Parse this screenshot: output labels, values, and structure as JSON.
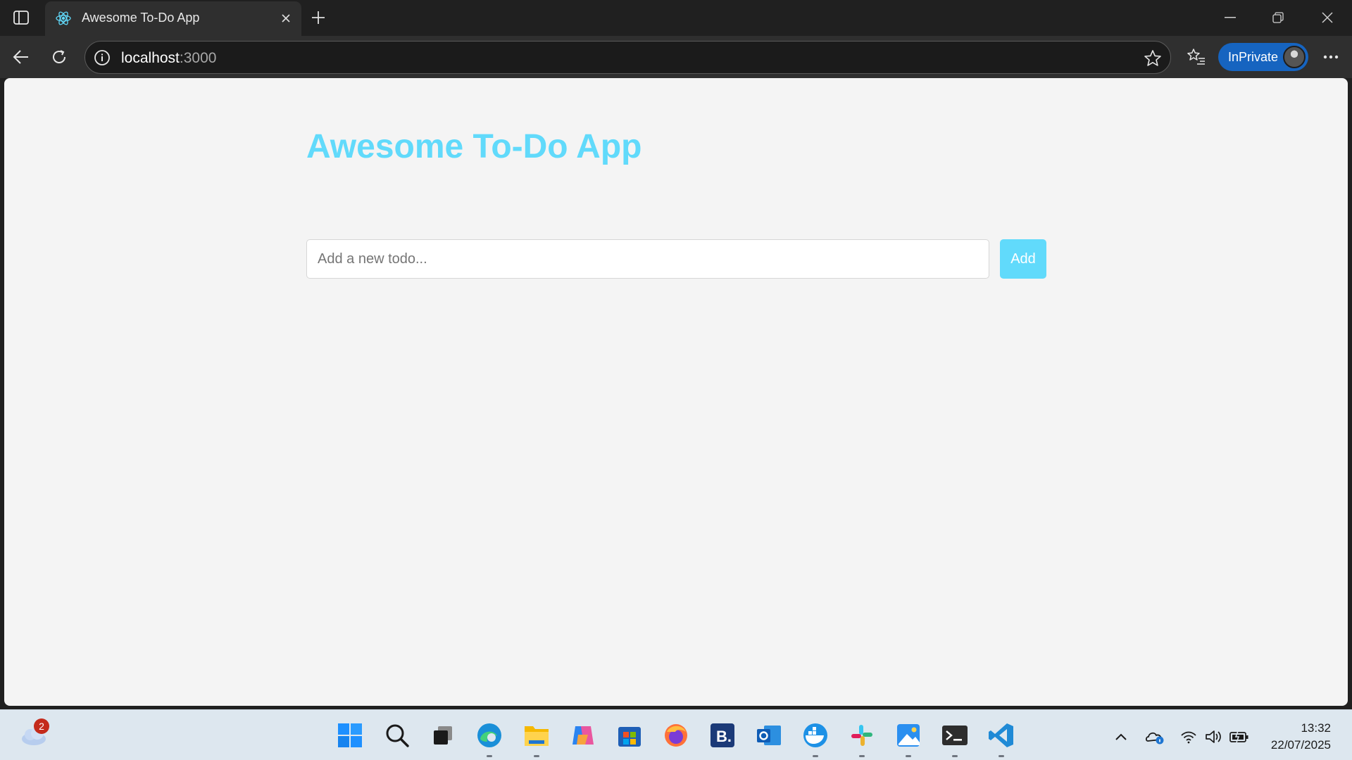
{
  "browser": {
    "tab": {
      "title": "Awesome To-Do App",
      "favicon": "react-atom-icon"
    },
    "address": {
      "host": "localhost",
      "port": ":3000"
    },
    "profile": {
      "label": "InPrivate"
    },
    "accent": "#1664c0"
  },
  "app": {
    "title": "Awesome To-Do App",
    "input_placeholder": "Add a new todo...",
    "input_value": "",
    "add_label": "Add",
    "accent": "#61dafb"
  },
  "taskbar": {
    "weather_badge": "2",
    "apps": [
      "start-icon",
      "search-icon",
      "task-view-icon",
      "edge-icon",
      "file-explorer-icon",
      "copilot-icon",
      "store-icon",
      "firefox-icon",
      "bitwarden-icon",
      "outlook-icon",
      "docker-icon",
      "slack-icon",
      "photos-icon",
      "terminal-icon",
      "vscode-icon"
    ],
    "clock": {
      "time": "13:32",
      "date": "22/07/2025"
    }
  }
}
